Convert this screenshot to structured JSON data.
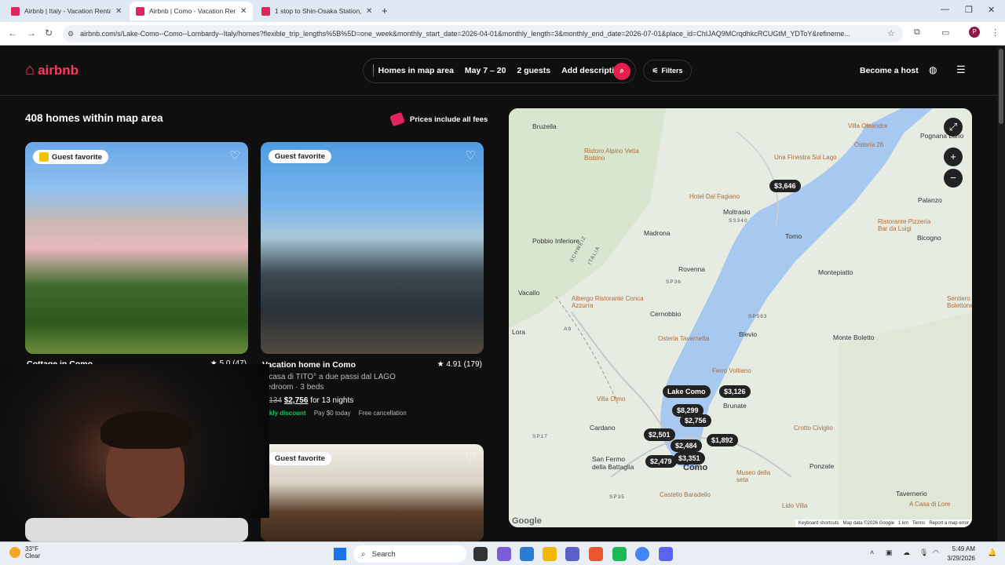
{
  "browser": {
    "tabs": [
      {
        "title": "Airbnb | Italy - Vacation Rentals"
      },
      {
        "title": "Airbnb | Como - Vacation Rentals"
      },
      {
        "title": "1 stop to Shin-Osaka Station, 1"
      }
    ],
    "url": "airbnb.com/s/Lake-Como--Como--Lombardy--Italy/homes?flexible_trip_lengths%5B%5D=one_week&monthly_start_date=2026-04-01&monthly_length=3&monthly_end_date=2026-07-01&place_id=ChIJAQ9MCrqdhkcRCUGtM_YDToY&refineme...",
    "profile_initial": "P"
  },
  "header": {
    "logo_text": "airbnb",
    "search": {
      "location": "Homes in map area",
      "dates": "May 7 – 20",
      "guests": "2 guests",
      "description": "Add description"
    },
    "filters_label": "Filters",
    "become_host": "Become a host"
  },
  "results": {
    "count_label": "408 homes within map area",
    "fees_note": "Prices include all fees"
  },
  "listings": [
    {
      "badge": "Guest favorite",
      "title": "Cottage in Como",
      "rating": "★ 5.0 (47)"
    },
    {
      "badge": "Guest favorite",
      "title": "Vacation home in Como",
      "rating": "★ 4.91 (179)",
      "description": "a casa di TITO° a due passi dal LAGO",
      "beds": "bedroom · 3 beds",
      "old_price": "3,134",
      "new_price": "$2,756",
      "price_suffix": "for 13 nights",
      "discount": "eekly discount",
      "pay": "Pay $0 today",
      "cancellation": "Free cancellation"
    },
    {
      "badge": "Guest favorite"
    }
  ],
  "map": {
    "pins": [
      {
        "label": "$3,646"
      },
      {
        "label": "Lake Como"
      },
      {
        "label": "$3,126"
      },
      {
        "label": "$8,299"
      },
      {
        "label": "$2,756"
      },
      {
        "label": "$2,501"
      },
      {
        "label": "$2,484"
      },
      {
        "label": "$1,892"
      },
      {
        "label": "$3,351"
      },
      {
        "label": "$2,479"
      }
    ],
    "places": [
      "Villa Oleandra",
      "Pognana Lario",
      "Ostería 26",
      "Una Finestra Sul Lago",
      "Ristoro Alpino Vetta Bisbino",
      "Hotel Dal Fagiano",
      "Moltrasio",
      "Palanzo",
      "Ristorante Pizzeria Bar da Luigi",
      "Madrona",
      "Torno",
      "Bicogno",
      "Pobbio Inferiore",
      "Rovenna",
      "Montepiatto",
      "Vacallo",
      "Albergo Ristorante Conca Azzurra",
      "Cernobbio",
      "Blevio",
      "Monte Boletto",
      "Osteria Tavernetta",
      "Ferro Voltiano",
      "Brunate",
      "Cardano",
      "Crotto Civiglio",
      "San Fermo della Battaglia",
      "Como",
      "Ponzate",
      "Museo della seta",
      "Tavernerio",
      "Castello Baradello",
      "Villa Olmo",
      "Bruzella",
      "Sentiero Bolettone",
      "Lido Villa",
      "A Casa di Lore",
      "Lora"
    ],
    "roads": [
      "SCHWEIZ",
      "ITALIA",
      "SS340",
      "SP583",
      "SP17",
      "A9",
      "SP36",
      "SP35"
    ],
    "attribution": [
      "Keyboard shortcuts",
      "Map data ©2026 Google",
      "1 km",
      "Terms",
      "Report a map error"
    ],
    "google_text": "Google"
  },
  "taskbar": {
    "weather_temp": "33°F",
    "weather_desc": "Clear",
    "search_placeholder": "Search",
    "time": "5:49 AM",
    "date": "3/29/2026"
  }
}
